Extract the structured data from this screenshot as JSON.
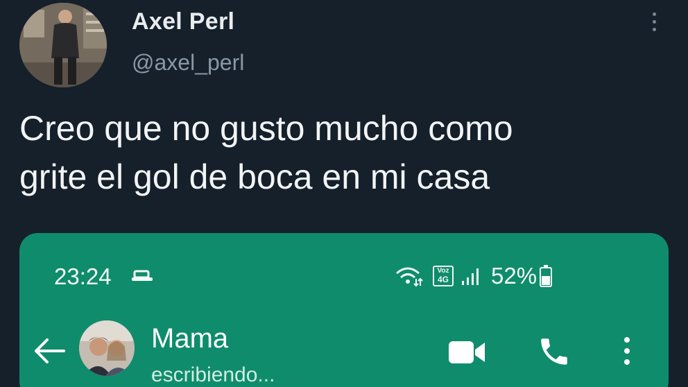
{
  "tweet": {
    "author_name": "Axel Perl",
    "author_handle": "@axel_perl",
    "text": "Creo que no gusto mucho como\ngrite el gol de boca en mi casa"
  },
  "screenshot": {
    "status_bar": {
      "time": "23:24",
      "volte_line1": "Voz",
      "volte_line2": "4G",
      "battery": "52%"
    },
    "chat_header": {
      "contact_name": "Mama",
      "status": "escribiendo..."
    }
  },
  "colors": {
    "background": "#15202b",
    "whatsapp_green": "#0f8c6c",
    "handle_gray": "#8b98a5"
  },
  "icons": {
    "tweet_menu": "more-vertical-icon",
    "cast": "cast-icon",
    "wifi": "wifi-icon",
    "signal": "signal-icon",
    "battery": "battery-icon",
    "back": "back-arrow-icon",
    "video": "video-camera-icon",
    "call": "phone-icon",
    "menu": "more-vertical-icon"
  }
}
